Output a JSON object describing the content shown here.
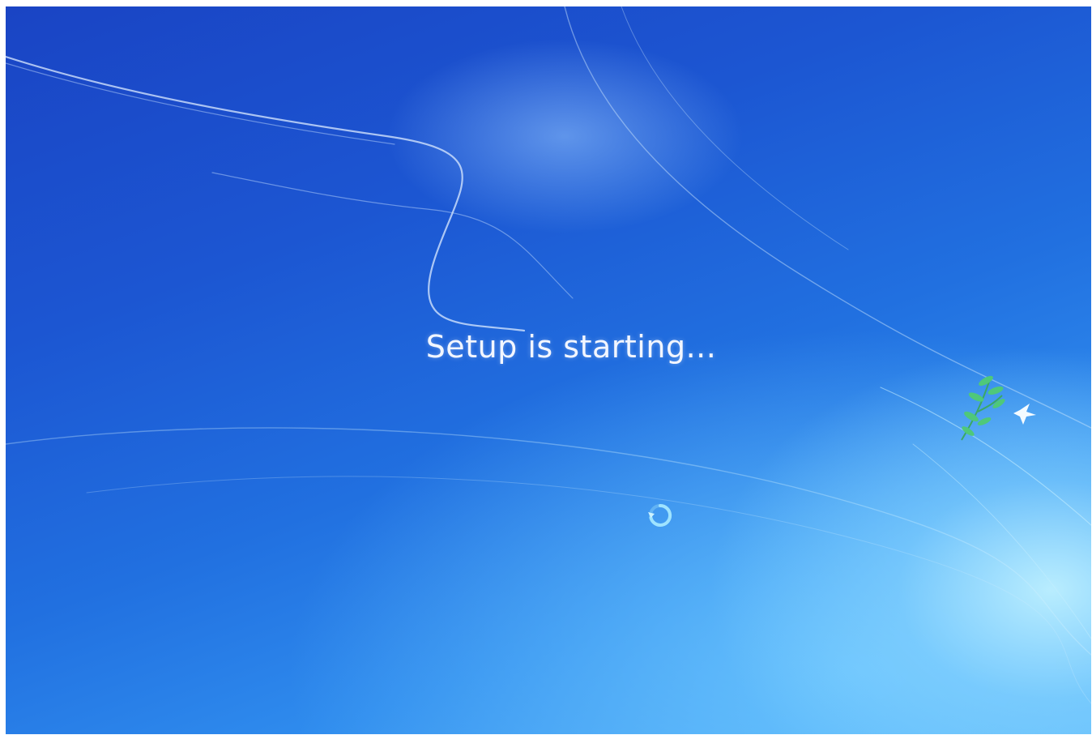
{
  "screen": {
    "status_text": "Setup is starting...",
    "spinner_icon": "loading-spinner-icon",
    "decoration_icon": "plant-with-bird-icon"
  },
  "colors": {
    "background_dark": "#1a44c4",
    "background_light": "#52b0f8",
    "text": "#f2f6ff",
    "spinner": "#9fe3ff",
    "leaf": "#4fc87a"
  }
}
